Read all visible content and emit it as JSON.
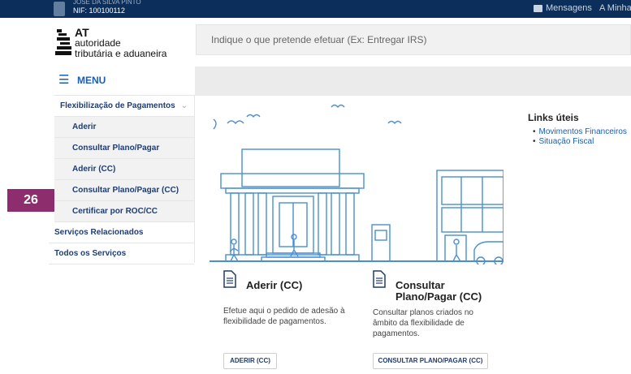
{
  "topbar": {
    "user_name_partial": "JOSÉ DA SILVA PINTO",
    "nif_label": "NIF: 100100112",
    "messages_label": "Mensagens",
    "my_area_label": "A Minha Á"
  },
  "header": {
    "logo_line1": "AT",
    "logo_line2": "autoridade",
    "logo_line3": "tributária e aduaneira",
    "search_placeholder": "Indique o que pretende efetuar (Ex: Entregar IRS)"
  },
  "menu": {
    "label": "MENU",
    "icon": "hamburger-icon"
  },
  "sidebar": {
    "parent": {
      "label": "Flexibilização de Pagamentos",
      "icon": "chevron-down-icon"
    },
    "items": [
      {
        "label": "Aderir"
      },
      {
        "label": "Consultar Plano/Pagar"
      },
      {
        "label": "Aderir (CC)"
      },
      {
        "label": "Consultar Plano/Pagar (CC)"
      },
      {
        "label": "Certificar por ROC/CC"
      }
    ],
    "related": "Serviços Relacionados",
    "all": "Todos os Serviços"
  },
  "step_badge": {
    "label": "26",
    "color": "#8e2d6e"
  },
  "links": {
    "title": "Links úteis",
    "items": [
      "Movimentos Financeiros",
      "Situação Fiscal"
    ]
  },
  "cards": [
    {
      "title": "Aderir (CC)",
      "description": "Efetue aqui o pedido de adesão à flexibilidade de pagamentos.",
      "button": "ADERIR (CC)",
      "icon": "document-icon"
    },
    {
      "title_line1": "Consultar",
      "title_line2": "Plano/Pagar (CC)",
      "description": "Consultar planos criados no âmbito da flexibilidade de pagamentos.",
      "button": "CONSULTAR PLANO/PAGAR (CC)",
      "icon": "document-icon"
    }
  ],
  "colors": {
    "brand_blue": "#1a5db4",
    "topbar": "#0b2f5a",
    "illustration": "#4a8fd6"
  }
}
